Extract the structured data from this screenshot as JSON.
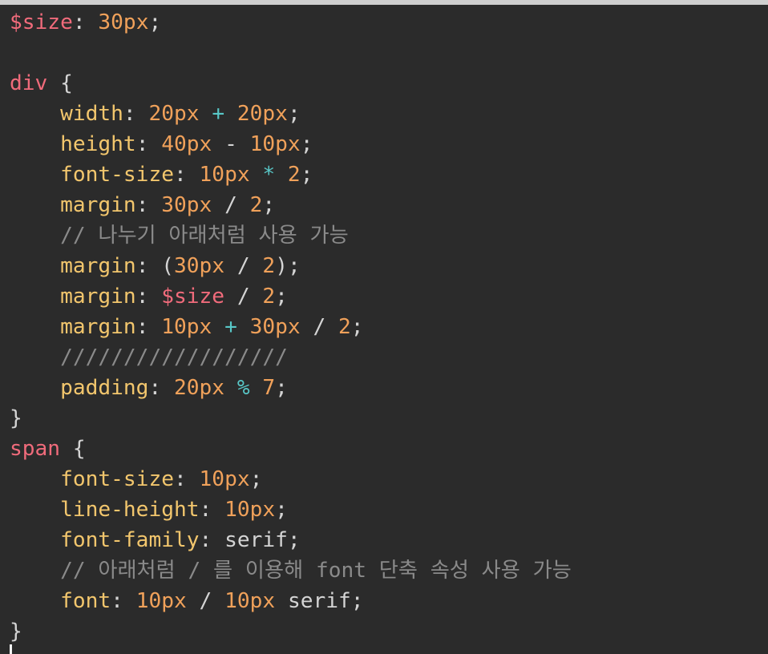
{
  "editor": {
    "lines": [
      [
        {
          "t": "$size",
          "c": "var"
        },
        {
          "t": ": ",
          "c": "punc"
        },
        {
          "t": "30px",
          "c": "num"
        },
        {
          "t": ";",
          "c": "punc"
        }
      ],
      [],
      [
        {
          "t": "div",
          "c": "sel"
        },
        {
          "t": " {",
          "c": "punc"
        }
      ],
      [
        {
          "t": "    ",
          "c": "punc"
        },
        {
          "t": "width",
          "c": "prop"
        },
        {
          "t": ": ",
          "c": "punc"
        },
        {
          "t": "20px",
          "c": "num"
        },
        {
          "t": " + ",
          "c": "op"
        },
        {
          "t": "20px",
          "c": "num"
        },
        {
          "t": ";",
          "c": "punc"
        }
      ],
      [
        {
          "t": "    ",
          "c": "punc"
        },
        {
          "t": "height",
          "c": "prop"
        },
        {
          "t": ": ",
          "c": "punc"
        },
        {
          "t": "40px",
          "c": "num"
        },
        {
          "t": " - ",
          "c": "punc"
        },
        {
          "t": "10px",
          "c": "num"
        },
        {
          "t": ";",
          "c": "punc"
        }
      ],
      [
        {
          "t": "    ",
          "c": "punc"
        },
        {
          "t": "font-size",
          "c": "prop"
        },
        {
          "t": ": ",
          "c": "punc"
        },
        {
          "t": "10px",
          "c": "num"
        },
        {
          "t": " * ",
          "c": "op"
        },
        {
          "t": "2",
          "c": "num"
        },
        {
          "t": ";",
          "c": "punc"
        }
      ],
      [
        {
          "t": "    ",
          "c": "punc"
        },
        {
          "t": "margin",
          "c": "prop"
        },
        {
          "t": ": ",
          "c": "punc"
        },
        {
          "t": "30px",
          "c": "num"
        },
        {
          "t": " / ",
          "c": "punc"
        },
        {
          "t": "2",
          "c": "num"
        },
        {
          "t": ";",
          "c": "punc"
        }
      ],
      [
        {
          "t": "    ",
          "c": "punc"
        },
        {
          "t": "// 나누기 아래처럼 사용 가능",
          "c": "comment"
        }
      ],
      [
        {
          "t": "    ",
          "c": "punc"
        },
        {
          "t": "margin",
          "c": "prop"
        },
        {
          "t": ": ",
          "c": "punc"
        },
        {
          "t": "(",
          "c": "paren"
        },
        {
          "t": "30px",
          "c": "num"
        },
        {
          "t": " / ",
          "c": "punc"
        },
        {
          "t": "2",
          "c": "num"
        },
        {
          "t": ");",
          "c": "punc"
        }
      ],
      [
        {
          "t": "    ",
          "c": "punc"
        },
        {
          "t": "margin",
          "c": "prop"
        },
        {
          "t": ": ",
          "c": "punc"
        },
        {
          "t": "$size",
          "c": "var"
        },
        {
          "t": " / ",
          "c": "punc"
        },
        {
          "t": "2",
          "c": "num"
        },
        {
          "t": ";",
          "c": "punc"
        }
      ],
      [
        {
          "t": "    ",
          "c": "punc"
        },
        {
          "t": "margin",
          "c": "prop"
        },
        {
          "t": ": ",
          "c": "punc"
        },
        {
          "t": "10px",
          "c": "num"
        },
        {
          "t": " + ",
          "c": "op"
        },
        {
          "t": "30px",
          "c": "num"
        },
        {
          "t": " / ",
          "c": "punc"
        },
        {
          "t": "2",
          "c": "num"
        },
        {
          "t": ";",
          "c": "punc"
        }
      ],
      [
        {
          "t": "    ",
          "c": "punc"
        },
        {
          "t": "//////////////////",
          "c": "comment"
        }
      ],
      [
        {
          "t": "    ",
          "c": "punc"
        },
        {
          "t": "padding",
          "c": "prop"
        },
        {
          "t": ": ",
          "c": "punc"
        },
        {
          "t": "20px",
          "c": "num"
        },
        {
          "t": " % ",
          "c": "op"
        },
        {
          "t": "7",
          "c": "num"
        },
        {
          "t": ";",
          "c": "punc"
        }
      ],
      [
        {
          "t": "}",
          "c": "punc"
        }
      ],
      [
        {
          "t": "span",
          "c": "sel"
        },
        {
          "t": " {",
          "c": "punc"
        }
      ],
      [
        {
          "t": "    ",
          "c": "punc"
        },
        {
          "t": "font-size",
          "c": "prop"
        },
        {
          "t": ": ",
          "c": "punc"
        },
        {
          "t": "10px",
          "c": "num"
        },
        {
          "t": ";",
          "c": "punc"
        }
      ],
      [
        {
          "t": "    ",
          "c": "punc"
        },
        {
          "t": "line-height",
          "c": "prop"
        },
        {
          "t": ": ",
          "c": "punc"
        },
        {
          "t": "10px",
          "c": "num"
        },
        {
          "t": ";",
          "c": "punc"
        }
      ],
      [
        {
          "t": "    ",
          "c": "punc"
        },
        {
          "t": "font-family",
          "c": "prop"
        },
        {
          "t": ": ",
          "c": "punc"
        },
        {
          "t": "serif",
          "c": "ident"
        },
        {
          "t": ";",
          "c": "punc"
        }
      ],
      [
        {
          "t": "    ",
          "c": "punc"
        },
        {
          "t": "// 아래처럼 / 를 이용해 font 단축 속성 사용 가능",
          "c": "comment"
        }
      ],
      [
        {
          "t": "    ",
          "c": "punc"
        },
        {
          "t": "font",
          "c": "prop"
        },
        {
          "t": ": ",
          "c": "punc"
        },
        {
          "t": "10px",
          "c": "num"
        },
        {
          "t": " / ",
          "c": "punc"
        },
        {
          "t": "10px",
          "c": "num"
        },
        {
          "t": " serif",
          "c": "ident"
        },
        {
          "t": ";",
          "c": "punc"
        }
      ],
      [
        {
          "t": "}",
          "c": "punc"
        }
      ]
    ]
  },
  "colors": {
    "background": "#2b2b2b",
    "variable": "#f06b7b",
    "number": "#f0a15a",
    "operator": "#58c7c7",
    "property": "#f2c66d",
    "comment": "#8a8a8a",
    "text": "#d4d4d4"
  }
}
